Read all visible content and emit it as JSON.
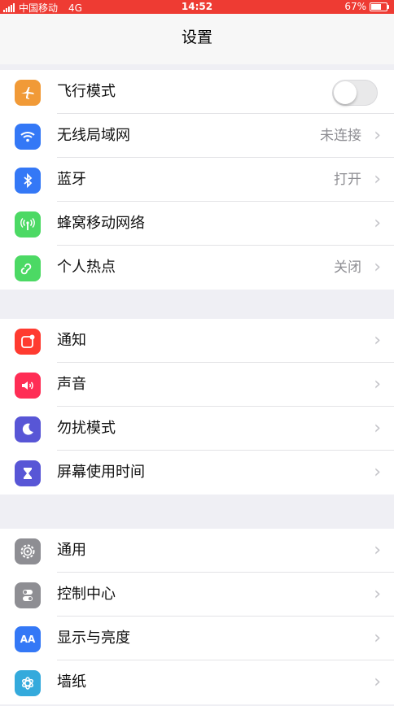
{
  "status_bar": {
    "carrier": "中国移动",
    "network": "4G",
    "time": "14:52",
    "battery": "67%",
    "battery_level": 0.67
  },
  "nav": {
    "title": "设置"
  },
  "groups": [
    {
      "items": [
        {
          "label": "飞行模式",
          "value": "",
          "icon": "airplane-icon",
          "color": "#f19a37",
          "type": "toggle",
          "toggle_on": false
        },
        {
          "label": "无线局域网",
          "value": "未连接",
          "icon": "wifi-icon",
          "color": "#3478f6",
          "type": "chevron"
        },
        {
          "label": "蓝牙",
          "value": "打开",
          "icon": "bluetooth-icon",
          "color": "#3478f6",
          "type": "chevron"
        },
        {
          "label": "蜂窝移动网络",
          "value": "",
          "icon": "cellular-icon",
          "color": "#4cd964",
          "type": "chevron"
        },
        {
          "label": "个人热点",
          "value": "关闭",
          "icon": "hotspot-icon",
          "color": "#4cd964",
          "type": "chevron"
        }
      ]
    },
    {
      "items": [
        {
          "label": "通知",
          "value": "",
          "icon": "notifications-icon",
          "color": "#ff3b30",
          "type": "chevron"
        },
        {
          "label": "声音",
          "value": "",
          "icon": "sound-icon",
          "color": "#ff2d55",
          "type": "chevron"
        },
        {
          "label": "勿扰模式",
          "value": "",
          "icon": "moon-icon",
          "color": "#5856d6",
          "type": "chevron"
        },
        {
          "label": "屏幕使用时间",
          "value": "",
          "icon": "hourglass-icon",
          "color": "#5856d6",
          "type": "chevron"
        }
      ]
    },
    {
      "items": [
        {
          "label": "通用",
          "value": "",
          "icon": "gear-icon",
          "color": "#8e8e93",
          "type": "chevron"
        },
        {
          "label": "控制中心",
          "value": "",
          "icon": "control-center-icon",
          "color": "#8e8e93",
          "type": "chevron"
        },
        {
          "label": "显示与亮度",
          "value": "",
          "icon": "display-brightness-icon",
          "color": "#3478f6",
          "type": "chevron"
        },
        {
          "label": "墙纸",
          "value": "",
          "icon": "wallpaper-icon",
          "color": "#34aadc",
          "type": "chevron"
        }
      ]
    }
  ]
}
